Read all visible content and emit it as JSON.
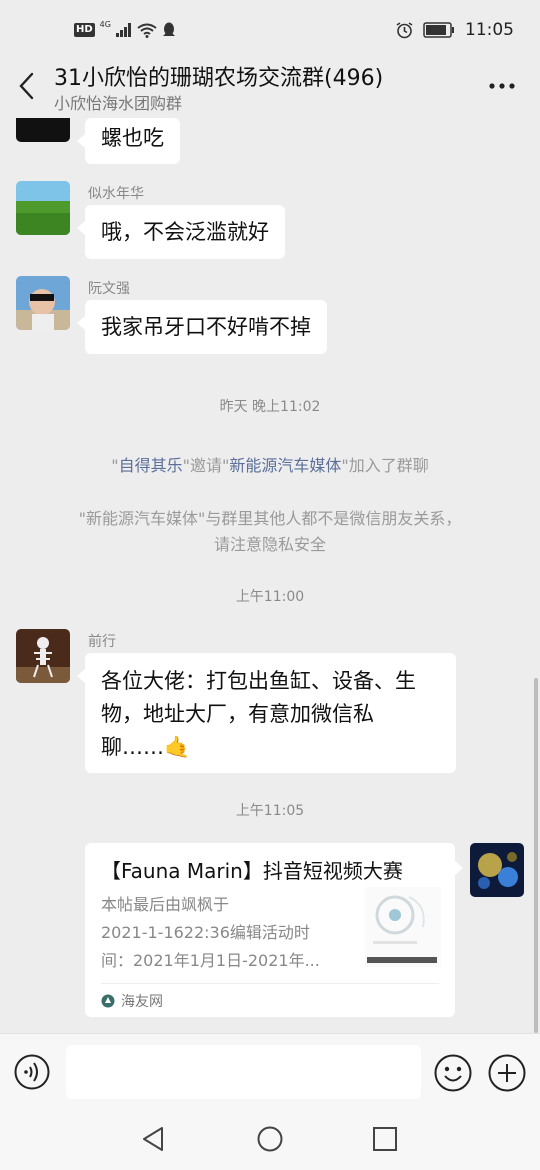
{
  "status": {
    "hd": "HD",
    "net": "4G",
    "time": "11:05"
  },
  "header": {
    "title": "31小欣怡的珊瑚农场交流群(496)",
    "subtitle": "小欣怡海水团购群"
  },
  "messages": [
    {
      "sender": "",
      "text": "螺也吃"
    },
    {
      "sender": "似水年华",
      "text": "哦，不会泛滥就好"
    },
    {
      "sender": "阮文强",
      "text": "我家吊牙口不好啃不掉"
    },
    {
      "sender": "前行",
      "text_line1": "各位大佬：打包出鱼缸、设备、生",
      "text_line2": "物，地址大厂，有意加微信私",
      "text_line3": "聊……",
      "emoji": "🤙"
    }
  ],
  "times": {
    "t1": "昨天 晚上11:02",
    "t2": "上午11:00",
    "t3": "上午11:05"
  },
  "system": {
    "inviter": "自得其乐",
    "invite_word": "邀请",
    "invitee": "新能源汽车媒体",
    "joined": "加入了群聊",
    "notice_line1": "\"新能源汽车媒体\"与群里其他人都不是微信朋友关系，",
    "notice_line2": "请注意隐私安全",
    "quote_open": "\"",
    "quote_close": "\""
  },
  "card": {
    "title": "【Fauna Marin】抖音短视频大赛",
    "desc_line1": "本帖最后由飒枫于",
    "desc_line2": "2021-1-1622:36编辑活动时",
    "desc_line3": "间：2021年1月1日-2021年...",
    "source": "海友网"
  },
  "colors": {
    "background": "#ededed",
    "bubble": "#ffffff",
    "link": "#5b6f99"
  }
}
